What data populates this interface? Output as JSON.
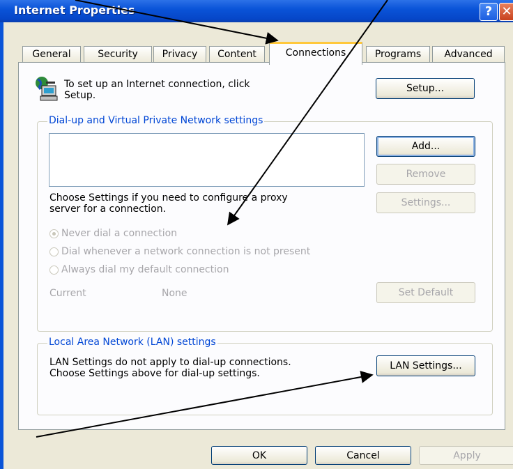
{
  "window": {
    "title": "Internet Properties",
    "help_glyph": "?",
    "close_glyph": "✕"
  },
  "tabs": [
    {
      "label": "General"
    },
    {
      "label": "Security"
    },
    {
      "label": "Privacy"
    },
    {
      "label": "Content"
    },
    {
      "label": "Connections",
      "active": true
    },
    {
      "label": "Programs"
    },
    {
      "label": "Advanced"
    }
  ],
  "setup": {
    "icon": "globe-computer-icon",
    "text_line1": "To set up an Internet connection, click",
    "text_line2": "Setup.",
    "button": "Setup..."
  },
  "dialup": {
    "legend": "Dial-up and Virtual Private Network settings",
    "add": "Add...",
    "remove": "Remove",
    "settings": "Settings...",
    "choose_line1": "Choose Settings if you need to configure a proxy",
    "choose_line2": "server for a connection.",
    "radio_never": "Never dial a connection",
    "radio_whenever": "Dial whenever a network connection is not present",
    "radio_always": "Always dial my default connection",
    "current_label": "Current",
    "current_value": "None",
    "set_default": "Set Default"
  },
  "lan": {
    "legend": "Local Area Network (LAN) settings",
    "line1": "LAN Settings do not apply to dial-up connections.",
    "line2": "Choose Settings above for dial-up settings.",
    "button": "LAN Settings..."
  },
  "footer": {
    "ok": "OK",
    "cancel": "Cancel",
    "apply": "Apply"
  },
  "colors": {
    "titlebar": "#0a54d8",
    "legend_text": "#0046d5",
    "tab_highlight": "#ffc83c"
  }
}
